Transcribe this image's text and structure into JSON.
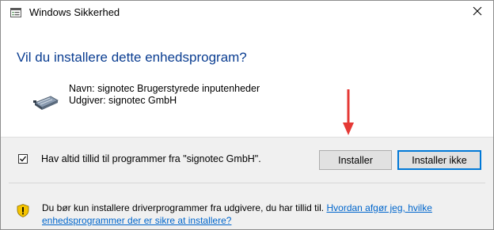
{
  "window": {
    "title": "Windows Sikkerhed",
    "heading": "Vil du installere dette enhedsprogram?"
  },
  "device": {
    "name_line": "Navn: signotec Brugerstyrede inputenheder",
    "publisher_line": "Udgiver: signotec GmbH"
  },
  "trust": {
    "checked": true,
    "label": "Hav altid tillid til programmer fra \"signotec GmbH\"."
  },
  "buttons": {
    "install": "Installer",
    "dont_install": "Installer ikke"
  },
  "warning": {
    "text": "Du bør kun installere driverprogrammer fra udgivere, du har tillid til. ",
    "link": "Hvordan afgør jeg, hvilke enhedsprogrammer der er sikre at installere?"
  },
  "colors": {
    "heading": "#0a3d91",
    "link": "#0066cc",
    "footer_bg": "#f0f0f0",
    "arrow": "#e53935",
    "focus_border": "#0078d7"
  },
  "icons": {
    "title": "window-icon",
    "close": "close-icon",
    "device": "device-icon",
    "warning": "shield-icon",
    "annotation": "arrow-down-icon"
  }
}
